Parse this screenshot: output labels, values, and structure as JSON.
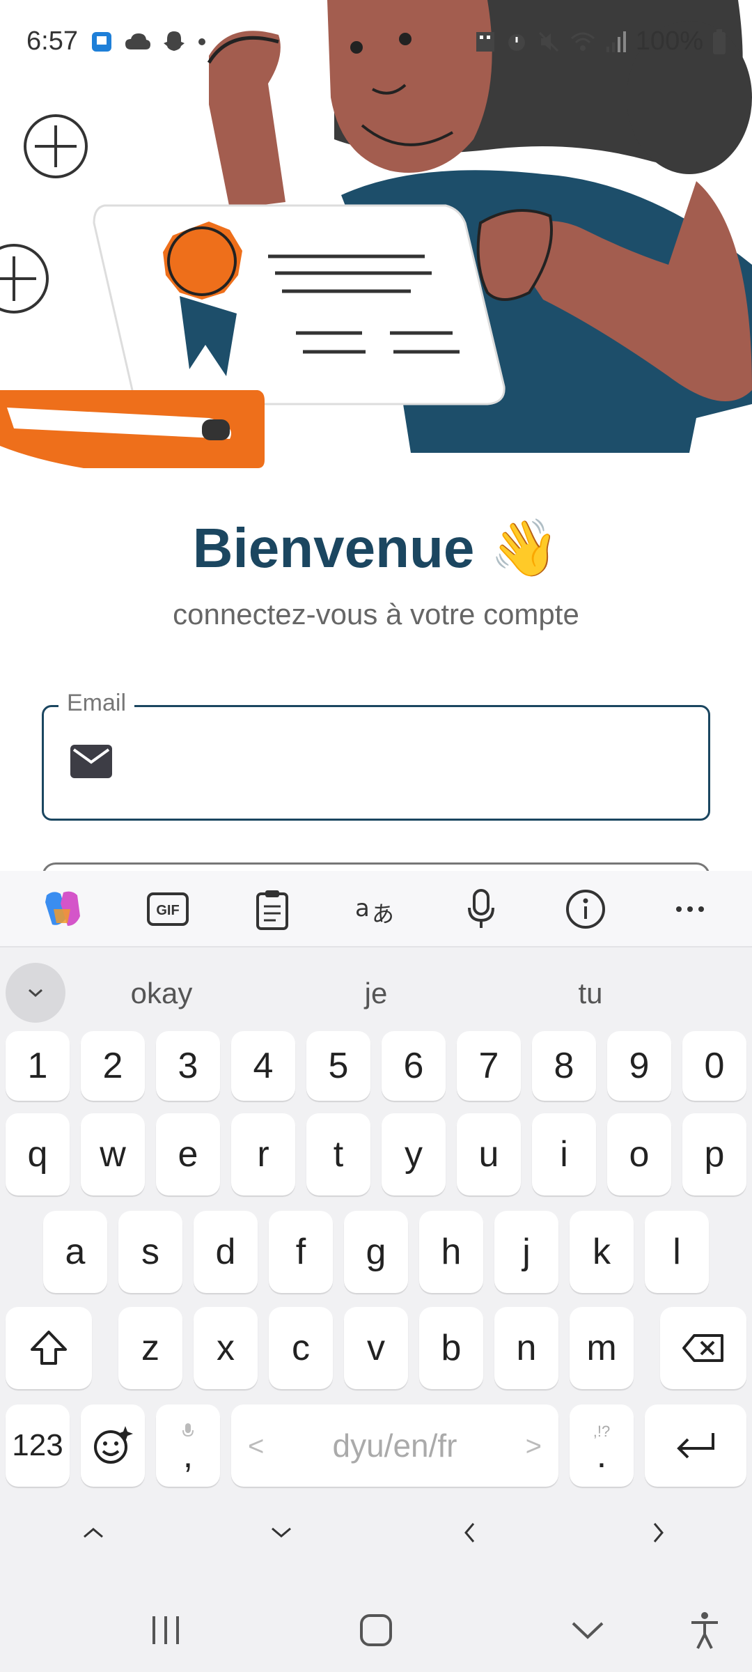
{
  "status_bar": {
    "time": "6:57",
    "battery": "100%"
  },
  "welcome": {
    "title": "Bienvenue",
    "wave_emoji": "👋",
    "subtitle": "connectez-vous à votre compte"
  },
  "form": {
    "email_label": "Email",
    "email_value": ""
  },
  "keyboard": {
    "toolbar": [
      "copilot-icon",
      "gif-icon",
      "clipboard-icon",
      "translate-icon",
      "microphone-icon",
      "info-icon",
      "more-icon"
    ],
    "suggestions": [
      "okay",
      "je",
      "tu"
    ],
    "row_numbers": [
      "1",
      "2",
      "3",
      "4",
      "5",
      "6",
      "7",
      "8",
      "9",
      "0"
    ],
    "row_1": [
      "q",
      "w",
      "e",
      "r",
      "t",
      "y",
      "u",
      "i",
      "o",
      "p"
    ],
    "row_2": [
      "a",
      "s",
      "d",
      "f",
      "g",
      "h",
      "j",
      "k",
      "l"
    ],
    "row_3": [
      "z",
      "x",
      "c",
      "v",
      "b",
      "n",
      "m"
    ],
    "key_123": "123",
    "key_comma": ",",
    "key_period": ".",
    "key_period_hint": ",!?",
    "space_label": "dyu/en/fr"
  },
  "colors": {
    "brand": "#1b4660",
    "accent_orange": "#ee6f1b",
    "keyboard_bg": "#f1f1f3"
  }
}
